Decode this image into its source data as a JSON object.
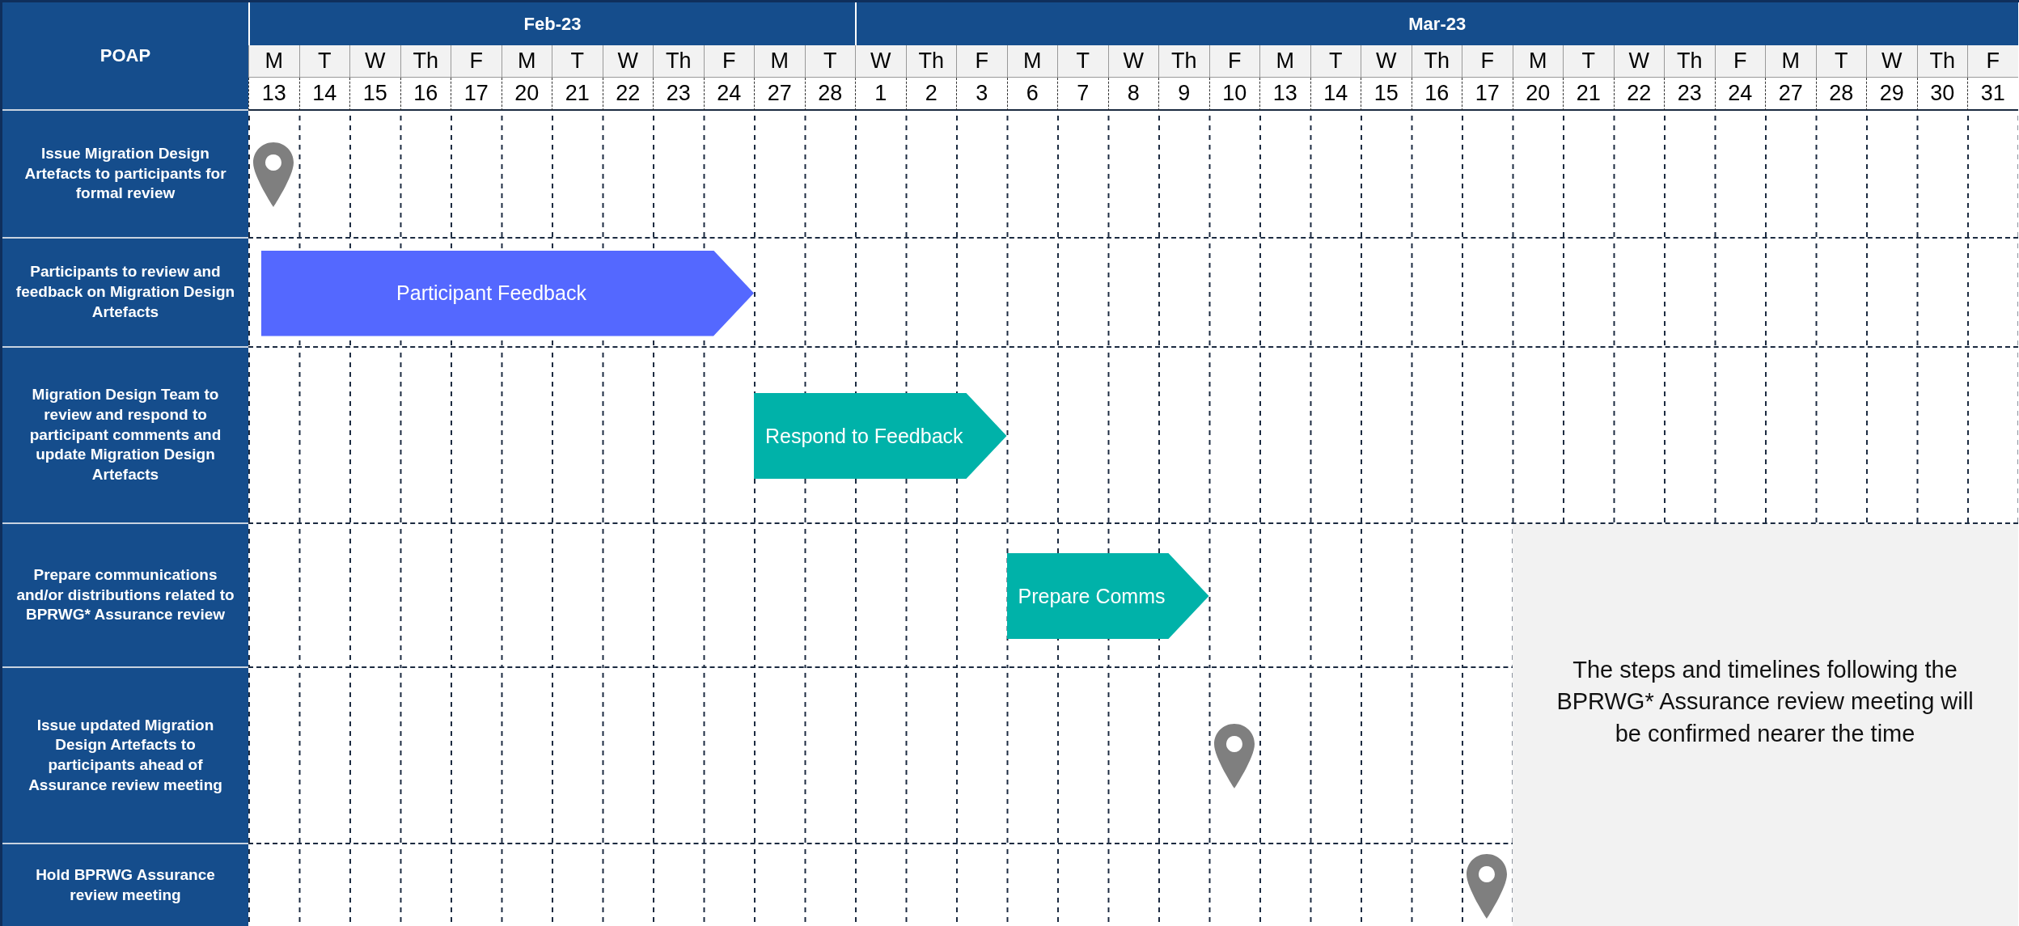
{
  "corner_header": "POAP",
  "months": [
    {
      "label": "Feb-23",
      "days": [
        {
          "weekday": "M",
          "date": "13"
        },
        {
          "weekday": "T",
          "date": "14"
        },
        {
          "weekday": "W",
          "date": "15"
        },
        {
          "weekday": "Th",
          "date": "16"
        },
        {
          "weekday": "F",
          "date": "17"
        },
        {
          "weekday": "M",
          "date": "20"
        },
        {
          "weekday": "T",
          "date": "21"
        },
        {
          "weekday": "W",
          "date": "22"
        },
        {
          "weekday": "Th",
          "date": "23"
        },
        {
          "weekday": "F",
          "date": "24"
        },
        {
          "weekday": "M",
          "date": "27"
        },
        {
          "weekday": "T",
          "date": "28"
        }
      ]
    },
    {
      "label": "Mar-23",
      "days": [
        {
          "weekday": "W",
          "date": "1"
        },
        {
          "weekday": "Th",
          "date": "2"
        },
        {
          "weekday": "F",
          "date": "3"
        },
        {
          "weekday": "M",
          "date": "6"
        },
        {
          "weekday": "T",
          "date": "7"
        },
        {
          "weekday": "W",
          "date": "8"
        },
        {
          "weekday": "Th",
          "date": "9"
        },
        {
          "weekday": "F",
          "date": "10"
        },
        {
          "weekday": "M",
          "date": "13"
        },
        {
          "weekday": "T",
          "date": "14"
        },
        {
          "weekday": "W",
          "date": "15"
        },
        {
          "weekday": "Th",
          "date": "16"
        },
        {
          "weekday": "F",
          "date": "17"
        },
        {
          "weekday": "M",
          "date": "20"
        },
        {
          "weekday": "T",
          "date": "21"
        },
        {
          "weekday": "W",
          "date": "22"
        },
        {
          "weekday": "Th",
          "date": "23"
        },
        {
          "weekday": "F",
          "date": "24"
        },
        {
          "weekday": "M",
          "date": "27"
        },
        {
          "weekday": "T",
          "date": "28"
        },
        {
          "weekday": "W",
          "date": "29"
        },
        {
          "weekday": "Th",
          "date": "30"
        },
        {
          "weekday": "F",
          "date": "31"
        }
      ]
    }
  ],
  "tasks": [
    {
      "label": "Issue Migration Design Artefacts to participants for formal review",
      "kind": "milestone"
    },
    {
      "label": "Participants to review and feedback on Migration Design Artefacts",
      "kind": "bar",
      "bar_label": "Participant Feedback",
      "color": "#5468ff"
    },
    {
      "label": "Migration Design Team to review and respond to participant comments and update Migration Design Artefacts",
      "kind": "bar",
      "bar_label": "Respond to Feedback",
      "color": "#00b2a9"
    },
    {
      "label": "Prepare communications and/or distributions related to BPRWG* Assurance review",
      "kind": "bar",
      "bar_label": "Prepare Comms",
      "color": "#00b2a9"
    },
    {
      "label": "Issue updated Migration Design Artefacts to participants ahead of Assurance review meeting",
      "kind": "milestone"
    },
    {
      "label": "Hold BPRWG Assurance review meeting",
      "kind": "milestone"
    }
  ],
  "note": "The steps and timelines following the BPRWG* Assurance review meeting will be confirmed nearer the time"
}
